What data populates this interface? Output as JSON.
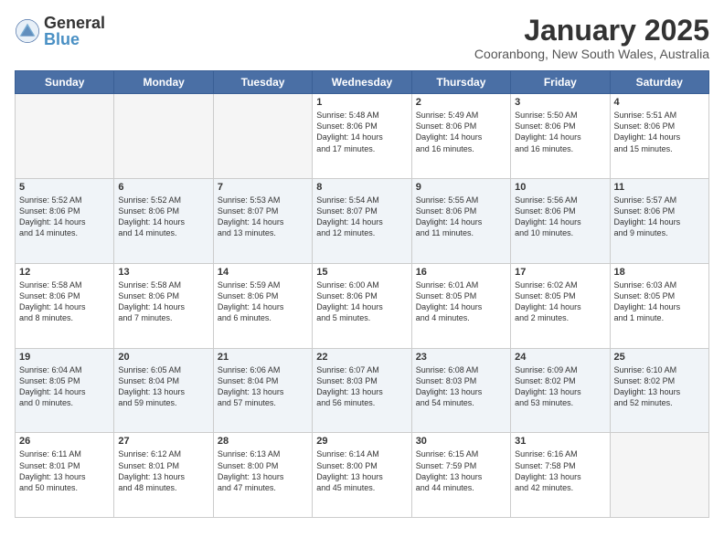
{
  "logo": {
    "general": "General",
    "blue": "Blue"
  },
  "header": {
    "month": "January 2025",
    "location": "Cooranbong, New South Wales, Australia"
  },
  "days": [
    "Sunday",
    "Monday",
    "Tuesday",
    "Wednesday",
    "Thursday",
    "Friday",
    "Saturday"
  ],
  "weeks": [
    [
      {
        "day": "",
        "text": ""
      },
      {
        "day": "",
        "text": ""
      },
      {
        "day": "",
        "text": ""
      },
      {
        "day": "1",
        "text": "Sunrise: 5:48 AM\nSunset: 8:06 PM\nDaylight: 14 hours\nand 17 minutes."
      },
      {
        "day": "2",
        "text": "Sunrise: 5:49 AM\nSunset: 8:06 PM\nDaylight: 14 hours\nand 16 minutes."
      },
      {
        "day": "3",
        "text": "Sunrise: 5:50 AM\nSunset: 8:06 PM\nDaylight: 14 hours\nand 16 minutes."
      },
      {
        "day": "4",
        "text": "Sunrise: 5:51 AM\nSunset: 8:06 PM\nDaylight: 14 hours\nand 15 minutes."
      }
    ],
    [
      {
        "day": "5",
        "text": "Sunrise: 5:52 AM\nSunset: 8:06 PM\nDaylight: 14 hours\nand 14 minutes."
      },
      {
        "day": "6",
        "text": "Sunrise: 5:52 AM\nSunset: 8:06 PM\nDaylight: 14 hours\nand 14 minutes."
      },
      {
        "day": "7",
        "text": "Sunrise: 5:53 AM\nSunset: 8:07 PM\nDaylight: 14 hours\nand 13 minutes."
      },
      {
        "day": "8",
        "text": "Sunrise: 5:54 AM\nSunset: 8:07 PM\nDaylight: 14 hours\nand 12 minutes."
      },
      {
        "day": "9",
        "text": "Sunrise: 5:55 AM\nSunset: 8:06 PM\nDaylight: 14 hours\nand 11 minutes."
      },
      {
        "day": "10",
        "text": "Sunrise: 5:56 AM\nSunset: 8:06 PM\nDaylight: 14 hours\nand 10 minutes."
      },
      {
        "day": "11",
        "text": "Sunrise: 5:57 AM\nSunset: 8:06 PM\nDaylight: 14 hours\nand 9 minutes."
      }
    ],
    [
      {
        "day": "12",
        "text": "Sunrise: 5:58 AM\nSunset: 8:06 PM\nDaylight: 14 hours\nand 8 minutes."
      },
      {
        "day": "13",
        "text": "Sunrise: 5:58 AM\nSunset: 8:06 PM\nDaylight: 14 hours\nand 7 minutes."
      },
      {
        "day": "14",
        "text": "Sunrise: 5:59 AM\nSunset: 8:06 PM\nDaylight: 14 hours\nand 6 minutes."
      },
      {
        "day": "15",
        "text": "Sunrise: 6:00 AM\nSunset: 8:06 PM\nDaylight: 14 hours\nand 5 minutes."
      },
      {
        "day": "16",
        "text": "Sunrise: 6:01 AM\nSunset: 8:05 PM\nDaylight: 14 hours\nand 4 minutes."
      },
      {
        "day": "17",
        "text": "Sunrise: 6:02 AM\nSunset: 8:05 PM\nDaylight: 14 hours\nand 2 minutes."
      },
      {
        "day": "18",
        "text": "Sunrise: 6:03 AM\nSunset: 8:05 PM\nDaylight: 14 hours\nand 1 minute."
      }
    ],
    [
      {
        "day": "19",
        "text": "Sunrise: 6:04 AM\nSunset: 8:05 PM\nDaylight: 14 hours\nand 0 minutes."
      },
      {
        "day": "20",
        "text": "Sunrise: 6:05 AM\nSunset: 8:04 PM\nDaylight: 13 hours\nand 59 minutes."
      },
      {
        "day": "21",
        "text": "Sunrise: 6:06 AM\nSunset: 8:04 PM\nDaylight: 13 hours\nand 57 minutes."
      },
      {
        "day": "22",
        "text": "Sunrise: 6:07 AM\nSunset: 8:03 PM\nDaylight: 13 hours\nand 56 minutes."
      },
      {
        "day": "23",
        "text": "Sunrise: 6:08 AM\nSunset: 8:03 PM\nDaylight: 13 hours\nand 54 minutes."
      },
      {
        "day": "24",
        "text": "Sunrise: 6:09 AM\nSunset: 8:02 PM\nDaylight: 13 hours\nand 53 minutes."
      },
      {
        "day": "25",
        "text": "Sunrise: 6:10 AM\nSunset: 8:02 PM\nDaylight: 13 hours\nand 52 minutes."
      }
    ],
    [
      {
        "day": "26",
        "text": "Sunrise: 6:11 AM\nSunset: 8:01 PM\nDaylight: 13 hours\nand 50 minutes."
      },
      {
        "day": "27",
        "text": "Sunrise: 6:12 AM\nSunset: 8:01 PM\nDaylight: 13 hours\nand 48 minutes."
      },
      {
        "day": "28",
        "text": "Sunrise: 6:13 AM\nSunset: 8:00 PM\nDaylight: 13 hours\nand 47 minutes."
      },
      {
        "day": "29",
        "text": "Sunrise: 6:14 AM\nSunset: 8:00 PM\nDaylight: 13 hours\nand 45 minutes."
      },
      {
        "day": "30",
        "text": "Sunrise: 6:15 AM\nSunset: 7:59 PM\nDaylight: 13 hours\nand 44 minutes."
      },
      {
        "day": "31",
        "text": "Sunrise: 6:16 AM\nSunset: 7:58 PM\nDaylight: 13 hours\nand 42 minutes."
      },
      {
        "day": "",
        "text": ""
      }
    ]
  ]
}
